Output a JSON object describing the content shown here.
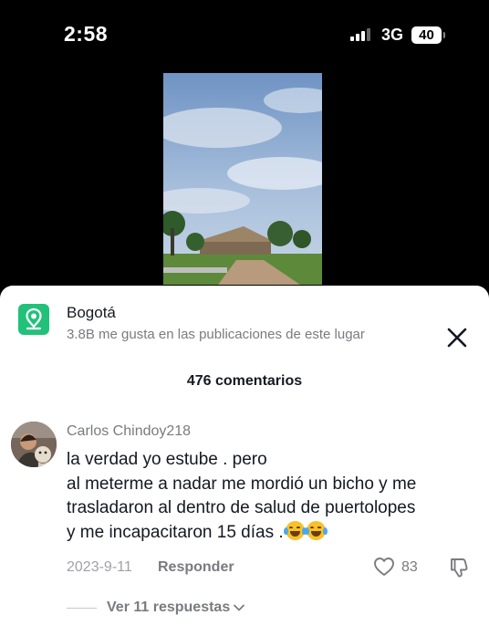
{
  "status_bar": {
    "time": "2:58",
    "network": "3G",
    "battery": "40"
  },
  "place": {
    "name": "Bogotá",
    "stats": "3.8B me gusta en las publicaciones de este lugar",
    "icon": "location-pin-icon",
    "accent_color": "#21c17a"
  },
  "comments_header": {
    "count_label": "476 comentarios"
  },
  "comment": {
    "author": "Carlos Chindoy218",
    "lines": [
      "la verdad yo estube . pero",
      "al meterme a nadar me mordió un bicho y me",
      "trasladaron al dentro de salud de puertolopes",
      "y me incapacitaron 15 días ."
    ],
    "emojis": [
      "tears-of-joy-emoji",
      "tears-of-joy-emoji"
    ],
    "date": "2023-9-11",
    "reply_label": "Responder",
    "like_count": "83",
    "view_replies_label": "Ver 11 respuestas"
  }
}
